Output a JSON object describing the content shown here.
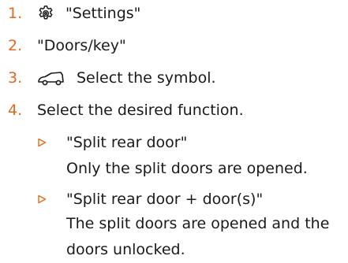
{
  "colors": {
    "accent": "#e06a1e",
    "text": "#1a1a1a"
  },
  "steps": [
    {
      "number": "1.",
      "icon": "gear-icon",
      "text": "\"Settings\""
    },
    {
      "number": "2.",
      "text": "\"Doors/key\""
    },
    {
      "number": "3.",
      "icon": "car-icon",
      "text": "Select the symbol."
    },
    {
      "number": "4.",
      "text": "Select the desired function."
    }
  ],
  "options": [
    {
      "bullet_icon": "triangle-right-icon",
      "label": "\"Split rear door\"",
      "description": "Only the split doors are opened."
    },
    {
      "bullet_icon": "triangle-right-icon",
      "label": "\"Split rear door + door(s)\"",
      "description": "The split doors are opened and the doors unlocked."
    }
  ]
}
